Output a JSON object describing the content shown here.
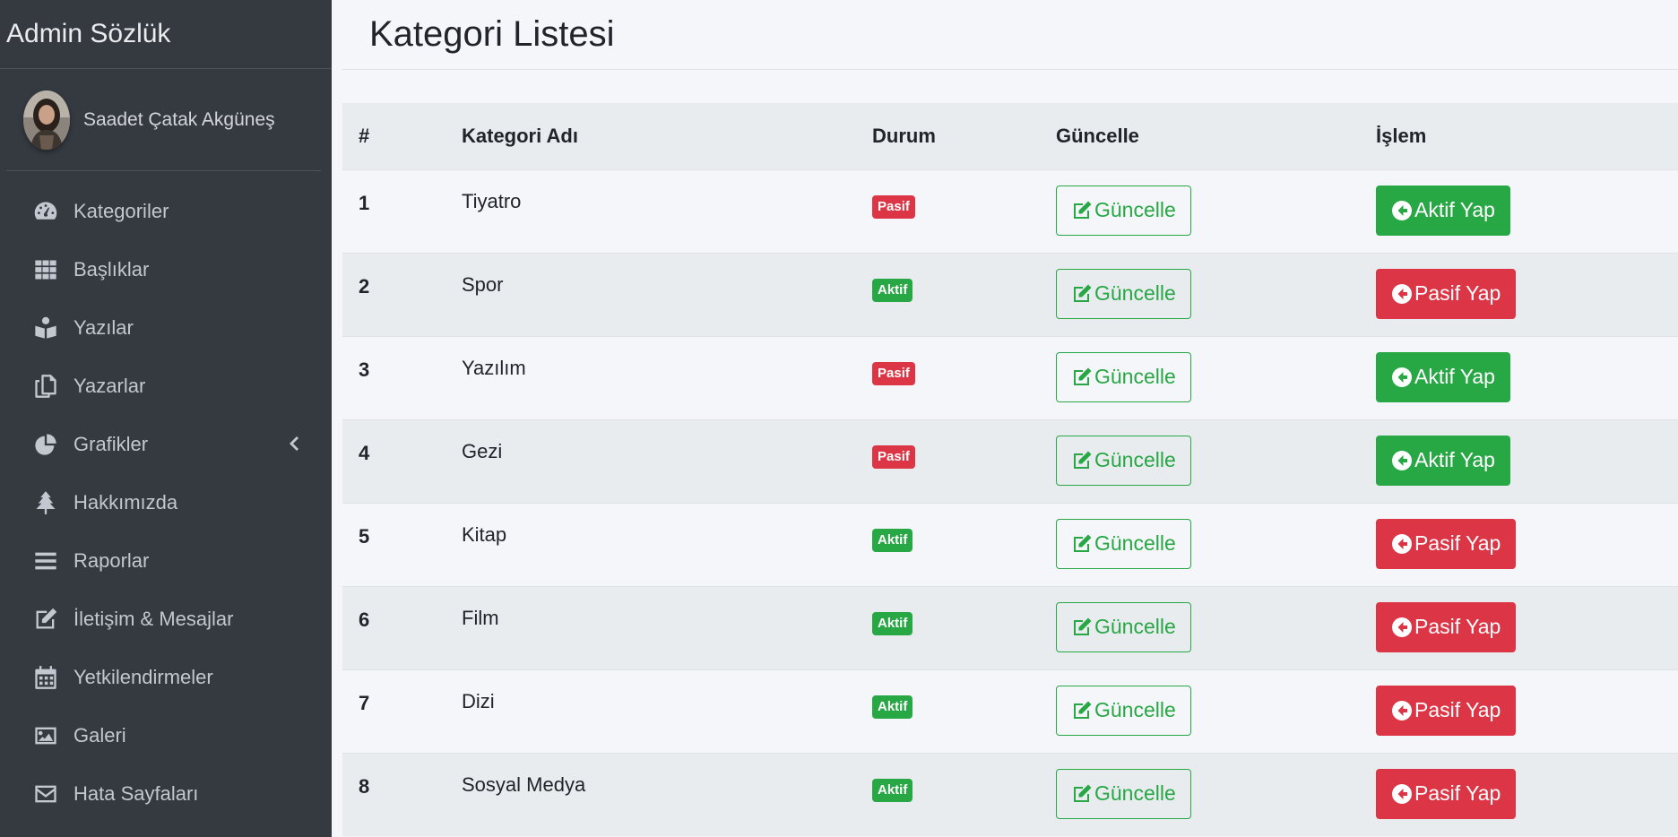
{
  "brand": {
    "title": "Admin Sözlük"
  },
  "user": {
    "name": "Saadet Çatak Akgüneş"
  },
  "sidebar": {
    "items": [
      {
        "label": "Kategoriler",
        "icon": "tachometer-icon"
      },
      {
        "label": "Başlıklar",
        "icon": "grid-icon"
      },
      {
        "label": "Yazılar",
        "icon": "book-reader-icon"
      },
      {
        "label": "Yazarlar",
        "icon": "copy-icon"
      },
      {
        "label": "Grafikler",
        "icon": "chart-pie-icon"
      },
      {
        "label": "Hakkımızda",
        "icon": "tree-icon"
      },
      {
        "label": "Raporlar",
        "icon": "bars-icon"
      },
      {
        "label": "İletişim & Mesajlar",
        "icon": "edit-icon"
      },
      {
        "label": "Yetkilendirmeler",
        "icon": "calendar-icon"
      },
      {
        "label": "Galeri",
        "icon": "image-icon"
      },
      {
        "label": "Hata Sayfaları",
        "icon": "envelope-icon"
      }
    ]
  },
  "page": {
    "title": "Kategori Listesi"
  },
  "table": {
    "headers": {
      "num": "#",
      "name": "Kategori Adı",
      "status": "Durum",
      "update": "Güncelle",
      "action": "İşlem"
    },
    "update_label": "Güncelle",
    "rows": [
      {
        "num": "1",
        "name": "Tiyatro",
        "status": "Pasif",
        "action": "Aktif Yap"
      },
      {
        "num": "2",
        "name": "Spor",
        "status": "Aktif",
        "action": "Pasif Yap"
      },
      {
        "num": "3",
        "name": "Yazılım",
        "status": "Pasif",
        "action": "Aktif Yap"
      },
      {
        "num": "4",
        "name": "Gezi",
        "status": "Pasif",
        "action": "Aktif Yap"
      },
      {
        "num": "5",
        "name": "Kitap",
        "status": "Aktif",
        "action": "Pasif Yap"
      },
      {
        "num": "6",
        "name": "Film",
        "status": "Aktif",
        "action": "Pasif Yap"
      },
      {
        "num": "7",
        "name": "Dizi",
        "status": "Aktif",
        "action": "Pasif Yap"
      },
      {
        "num": "8",
        "name": "Sosyal Medya",
        "status": "Aktif",
        "action": "Pasif Yap"
      }
    ]
  },
  "colors": {
    "sidebar_bg": "#343a40",
    "success": "#28a745",
    "danger": "#dc3545",
    "content_bg": "#f4f6f9"
  }
}
